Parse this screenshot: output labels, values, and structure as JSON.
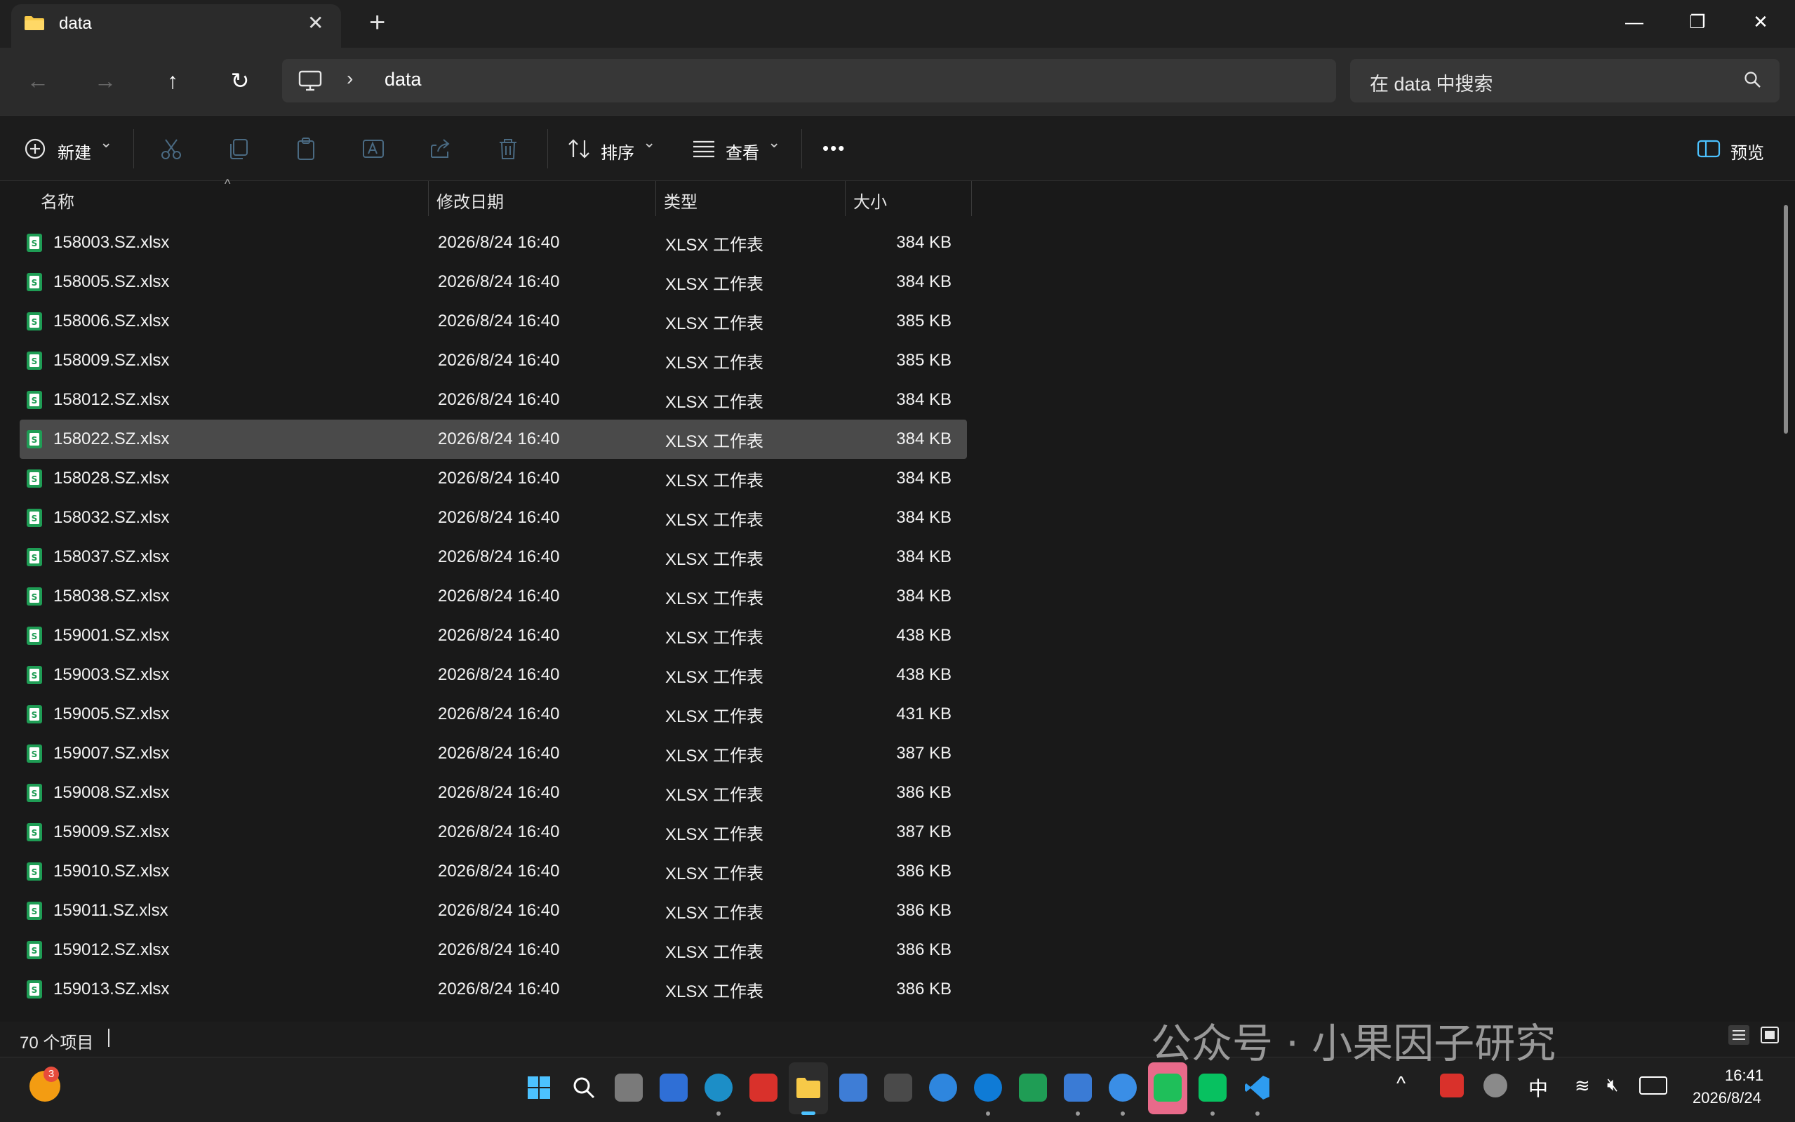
{
  "window": {
    "tab_title": "data",
    "new_tab": "+",
    "close_tab": "✕",
    "minimize": "—",
    "restore": "❐",
    "close": "✕"
  },
  "nav": {
    "back": "←",
    "forward": "→",
    "up": "↑",
    "refresh": "↻",
    "path_separator": "›",
    "path": "data",
    "search_placeholder": "在 data 中搜索"
  },
  "toolbar": {
    "new_label": "新建",
    "sort_label": "排序",
    "view_label": "查看",
    "more_label": "•••",
    "preview_label": "预览",
    "caret": "⌄"
  },
  "columns": {
    "name": "名称",
    "date": "修改日期",
    "type": "类型",
    "size": "大小",
    "sort_indicator": "^"
  },
  "files": [
    {
      "name": "158003.SZ.xlsx",
      "date": "2026/8/24 16:40",
      "type": "XLSX 工作表",
      "size": "384 KB"
    },
    {
      "name": "158005.SZ.xlsx",
      "date": "2026/8/24 16:40",
      "type": "XLSX 工作表",
      "size": "384 KB"
    },
    {
      "name": "158006.SZ.xlsx",
      "date": "2026/8/24 16:40",
      "type": "XLSX 工作表",
      "size": "385 KB"
    },
    {
      "name": "158009.SZ.xlsx",
      "date": "2026/8/24 16:40",
      "type": "XLSX 工作表",
      "size": "385 KB"
    },
    {
      "name": "158012.SZ.xlsx",
      "date": "2026/8/24 16:40",
      "type": "XLSX 工作表",
      "size": "384 KB"
    },
    {
      "name": "158022.SZ.xlsx",
      "date": "2026/8/24 16:40",
      "type": "XLSX 工作表",
      "size": "384 KB",
      "selected": true
    },
    {
      "name": "158028.SZ.xlsx",
      "date": "2026/8/24 16:40",
      "type": "XLSX 工作表",
      "size": "384 KB"
    },
    {
      "name": "158032.SZ.xlsx",
      "date": "2026/8/24 16:40",
      "type": "XLSX 工作表",
      "size": "384 KB"
    },
    {
      "name": "158037.SZ.xlsx",
      "date": "2026/8/24 16:40",
      "type": "XLSX 工作表",
      "size": "384 KB"
    },
    {
      "name": "158038.SZ.xlsx",
      "date": "2026/8/24 16:40",
      "type": "XLSX 工作表",
      "size": "384 KB"
    },
    {
      "name": "159001.SZ.xlsx",
      "date": "2026/8/24 16:40",
      "type": "XLSX 工作表",
      "size": "438 KB"
    },
    {
      "name": "159003.SZ.xlsx",
      "date": "2026/8/24 16:40",
      "type": "XLSX 工作表",
      "size": "438 KB"
    },
    {
      "name": "159005.SZ.xlsx",
      "date": "2026/8/24 16:40",
      "type": "XLSX 工作表",
      "size": "431 KB"
    },
    {
      "name": "159007.SZ.xlsx",
      "date": "2026/8/24 16:40",
      "type": "XLSX 工作表",
      "size": "387 KB"
    },
    {
      "name": "159008.SZ.xlsx",
      "date": "2026/8/24 16:40",
      "type": "XLSX 工作表",
      "size": "386 KB"
    },
    {
      "name": "159009.SZ.xlsx",
      "date": "2026/8/24 16:40",
      "type": "XLSX 工作表",
      "size": "387 KB"
    },
    {
      "name": "159010.SZ.xlsx",
      "date": "2026/8/24 16:40",
      "type": "XLSX 工作表",
      "size": "386 KB"
    },
    {
      "name": "159011.SZ.xlsx",
      "date": "2026/8/24 16:40",
      "type": "XLSX 工作表",
      "size": "386 KB"
    },
    {
      "name": "159012.SZ.xlsx",
      "date": "2026/8/24 16:40",
      "type": "XLSX 工作表",
      "size": "386 KB"
    },
    {
      "name": "159013.SZ.xlsx",
      "date": "2026/8/24 16:40",
      "type": "XLSX 工作表",
      "size": "386 KB"
    }
  ],
  "status": {
    "item_count": "70 个项目"
  },
  "taskbar": {
    "weather_badge": "3",
    "ime": "中",
    "time": "16:41",
    "date": "2026/8/24"
  },
  "watermark": "公众号 · 小果因子研究",
  "colors": {
    "excel_green": "#1f9d55",
    "selection": "#4a4a4a",
    "accent_blue": "#4cc2ff",
    "folder_yellow": "#f7c948"
  }
}
